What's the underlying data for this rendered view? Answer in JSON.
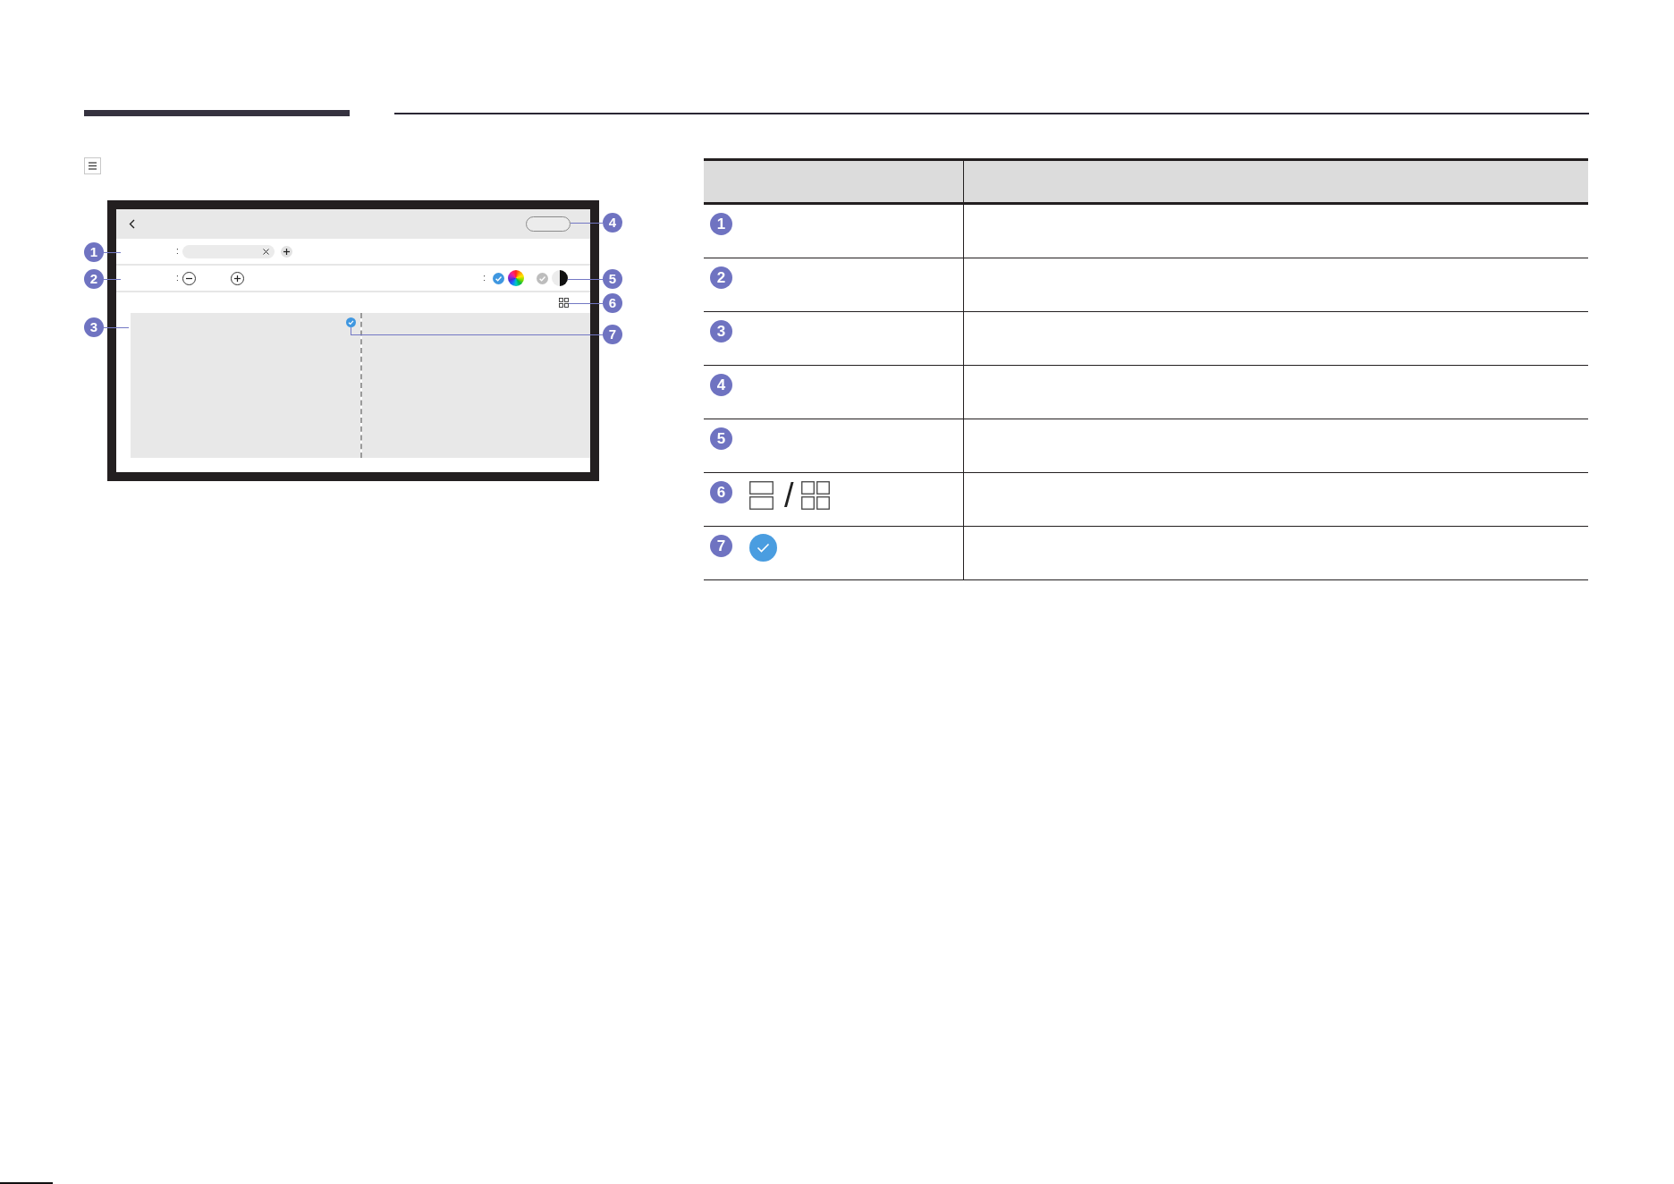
{
  "device_screen": {
    "file_row": {
      "colon": ":"
    },
    "zoom_row": {
      "colon": ":",
      "mode_colon": ":",
      "modes": [
        {
          "kind": "color",
          "selected": true
        },
        {
          "kind": "mono",
          "selected": false
        }
      ]
    },
    "preview": {
      "pages": [
        {
          "selected": true
        },
        {
          "selected": false
        }
      ]
    },
    "callouts": [
      "1",
      "2",
      "3",
      "4",
      "5",
      "6",
      "7"
    ]
  },
  "table": {
    "rows": [
      {
        "number": "1",
        "kind": "plain"
      },
      {
        "number": "2",
        "kind": "plain"
      },
      {
        "number": "3",
        "kind": "plain"
      },
      {
        "number": "4",
        "kind": "plain"
      },
      {
        "number": "5",
        "kind": "plain"
      },
      {
        "number": "6",
        "kind": "layout_icons",
        "separator": "/"
      },
      {
        "number": "7",
        "kind": "check_icon"
      }
    ]
  }
}
